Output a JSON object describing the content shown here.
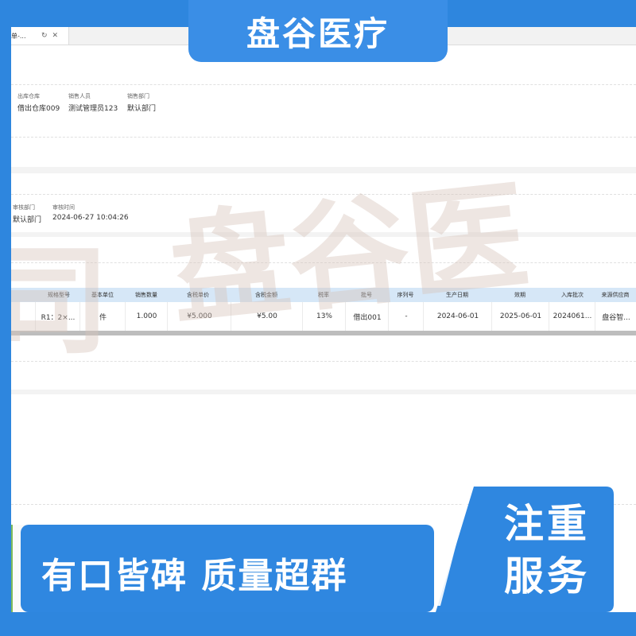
{
  "brand": {
    "top_title": "盘谷医疗",
    "slogan": "有口皆碑  质量超群",
    "badge_line1": "注重",
    "badge_line2": "服务",
    "watermark": "盘谷医",
    "watermark_left": "司"
  },
  "colors": {
    "brand_blue": "#2e86de",
    "grid_header": "#d6e7f7"
  },
  "tab": {
    "title": "单-...",
    "refresh_icon": "refresh-icon",
    "close_icon": "close-icon"
  },
  "form1": [
    {
      "label": "出库仓库",
      "value": "借出仓库009"
    },
    {
      "label": "销售人员",
      "value": "测试管理员123"
    },
    {
      "label": "销售部门",
      "value": "默认部门"
    }
  ],
  "form2": [
    {
      "label": "审核部门",
      "value": "默认部门"
    },
    {
      "label": "审核时间",
      "value": "2024-06-27 10:04:26"
    }
  ],
  "table": {
    "headers": [
      "规格型号",
      "基本单位",
      "销售数量",
      "含税单价",
      "含税金额",
      "税率",
      "批号",
      "序列号",
      "生产日期",
      "效期",
      "入库批次",
      "来源供应商"
    ],
    "row": [
      "R1：2×...",
      "件",
      "1.000",
      "¥5.000",
      "¥5.00",
      "13%",
      "借出001",
      "-",
      "2024-06-01",
      "2025-06-01",
      "2024061...",
      "盘谷智..."
    ]
  }
}
